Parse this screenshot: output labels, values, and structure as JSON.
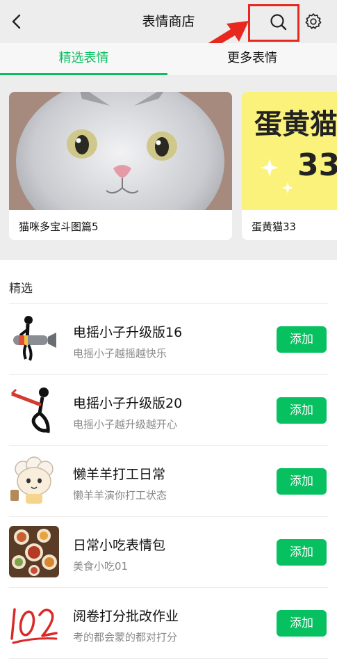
{
  "header": {
    "title": "表情商店"
  },
  "tabs": [
    {
      "label": "精选表情",
      "active": true
    },
    {
      "label": "更多表情",
      "active": false
    }
  ],
  "banners": [
    {
      "label": "猫咪多宝斗图篇5"
    },
    {
      "label": "蛋黄猫33",
      "art_text": "蛋黄猫",
      "art_number": "33"
    }
  ],
  "featured": {
    "title": "精选",
    "items": [
      {
        "name": "电摇小子升级版16",
        "desc": "电摇小子越摇越快乐",
        "button": "添加",
        "icon": "stickman-rocket-icon"
      },
      {
        "name": "电摇小子升级版20",
        "desc": "电摇小子越升级越开心",
        "button": "添加",
        "icon": "stickman-gun-icon"
      },
      {
        "name": "懒羊羊打工日常",
        "desc": "懒羊羊演你打工状态",
        "button": "添加",
        "icon": "lazy-sheep-icon"
      },
      {
        "name": "日常小吃表情包",
        "desc": "美食小吃01",
        "button": "添加",
        "icon": "food-platter-icon"
      },
      {
        "name": "阅卷打分批改作业",
        "desc": "考的都会蒙的都对打分",
        "button": "添加",
        "icon": "score-100-icon"
      }
    ]
  },
  "colors": {
    "accent": "#07c160",
    "highlight_box": "#e8281f",
    "background": "#ededed"
  }
}
